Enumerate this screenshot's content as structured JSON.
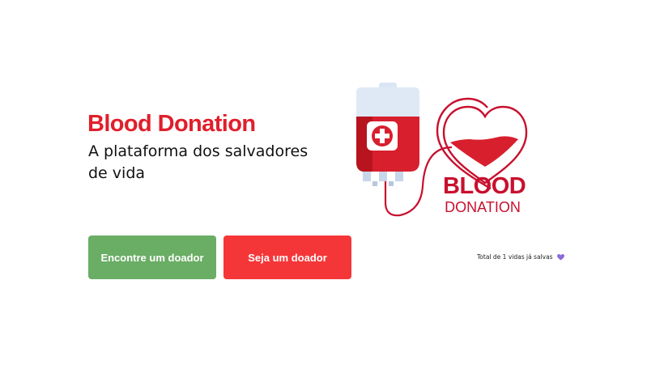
{
  "hero": {
    "title": "Blood Donation",
    "subtitle": "A plataforma dos salvadores de vida"
  },
  "actions": {
    "find_donor_label": "Encontre um doador",
    "become_donor_label": "Seja um doador"
  },
  "stats": {
    "lives_saved_text": "Total de 1 vidas já salvas",
    "heart_icon": "purple-heart-icon"
  },
  "logo": {
    "line1": "BLOOD",
    "line2": "DONATION"
  },
  "colors": {
    "brand_red": "#e01f2b",
    "find_button": "#6aad65",
    "become_button": "#f53638",
    "heart_purple": "#8b6ad9"
  }
}
